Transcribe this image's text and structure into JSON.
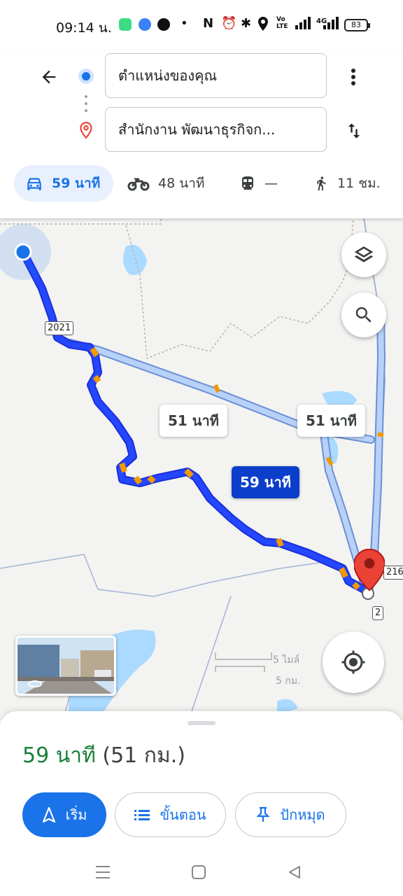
{
  "status_bar": {
    "time": "09:14 น.",
    "battery": "83",
    "network": "4G",
    "volte": "Vo LTE"
  },
  "directions": {
    "origin": "ตำแหน่งของคุณ",
    "destination": "สำนักงาน พัฒนาธุรกิจก...",
    "modes": [
      {
        "icon": "car-icon",
        "label": "59 นาที",
        "active": true
      },
      {
        "icon": "motorcycle-icon",
        "label": "48 นาที"
      },
      {
        "icon": "transit-icon",
        "label": "—"
      },
      {
        "icon": "walk-icon",
        "label": "11 ชม."
      }
    ]
  },
  "map": {
    "route_labels": [
      "51 นาที",
      "51 นาที",
      "59 นาที"
    ],
    "road_shields": [
      "2021",
      "2",
      "216"
    ],
    "scale": {
      "top": "5 ไมล์",
      "bottom": "5 กม."
    },
    "colors": {
      "selected_route": "#1a3dff",
      "alt_route": "#a9c8f5",
      "traffic": "#f29900",
      "dest_pin": "#ea4335"
    }
  },
  "sheet": {
    "duration": "59 นาที",
    "distance": "(51 กม.)",
    "start_label": "เริ่ม",
    "steps_label": "ขั้นตอน",
    "pin_label": "ปักหมุด"
  }
}
